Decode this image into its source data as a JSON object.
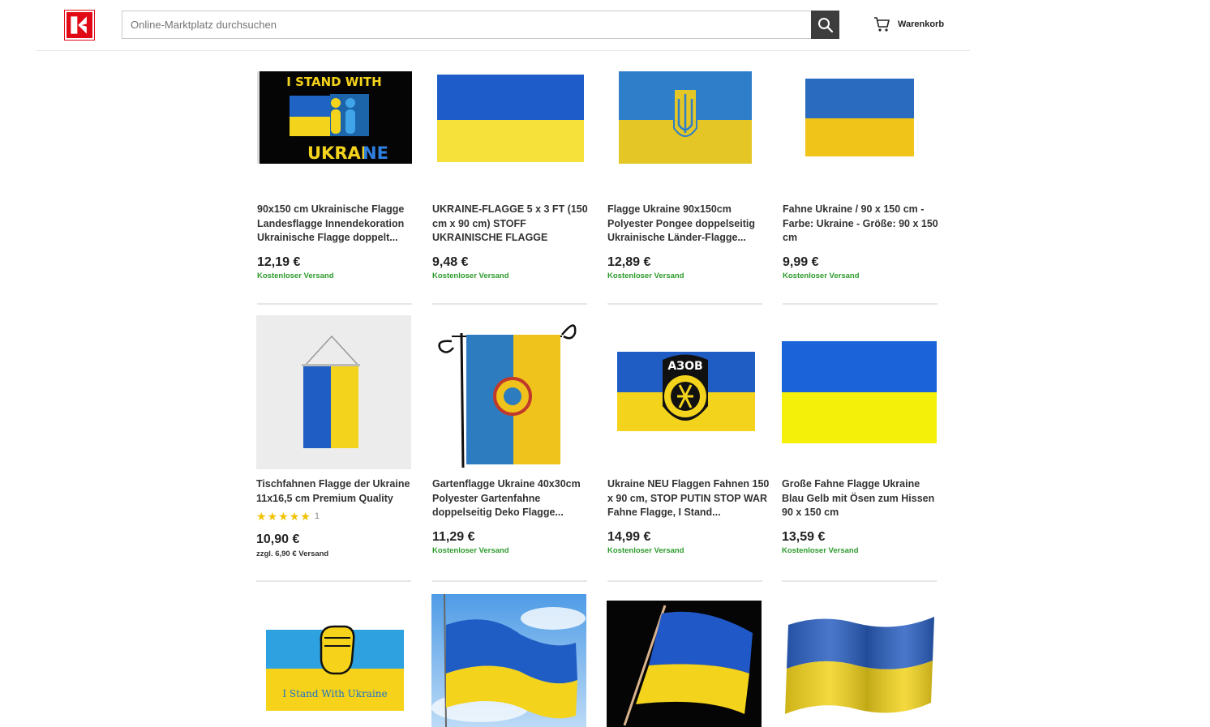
{
  "header": {
    "logo_letter": "K",
    "search_placeholder": "Online-Marktplatz durchsuchen",
    "cart_label": "Warenkorb"
  },
  "products": [
    {
      "title": "90x150 cm Ukrainische Flagge Landesflagge Innendekoration Ukrainische Flagge doppelt...",
      "price": "12,19 €",
      "shipping": "Kostenloser Versand",
      "image_text_top": "I STAND WITH",
      "image_text_bottom": "UKRAI",
      "image_text_bottom_accent": "NE"
    },
    {
      "title": "UKRAINE-FLAGGE 5 x 3 FT (150 cm x 90 cm) STOFF UKRAINISCHE FLAGGE",
      "price": "9,48 €",
      "shipping": "Kostenloser Versand"
    },
    {
      "title": "Flagge Ukraine 90x150cm Polyester Pongee doppelseitig Ukrainische Länder-Flagge...",
      "price": "12,89 €",
      "shipping": "Kostenloser Versand"
    },
    {
      "title": "Fahne Ukraine / 90 x 150 cm - Farbe: Ukraine - Größe: 90 x 150 cm",
      "price": "9,99 €",
      "shipping": "Kostenloser Versand"
    },
    {
      "title": "Tischfahnen Flagge der Ukraine 11x16,5 cm Premium Quality",
      "price": "10,90 €",
      "shipping": "zzgl. 6,90 € Versand",
      "rating": 5,
      "rating_count": "1"
    },
    {
      "title": "Gartenflagge Ukraine 40x30cm Polyester Gartenfahne doppelseitig Deko Flagge...",
      "price": "11,29 €",
      "shipping": "Kostenloser Versand"
    },
    {
      "title": "Ukraine NEU Flaggen Fahnen 150 x 90 cm, STOP PUTIN STOP WAR Fahne Flagge, I Stand...",
      "price": "14,99 €",
      "shipping": "Kostenloser Versand",
      "image_text": "АЗОВ"
    },
    {
      "title": "Große Fahne Flagge Ukraine Blau Gelb mit Ösen zum Hissen 90 x 150 cm",
      "price": "13,59 €",
      "shipping": "Kostenloser Versand"
    },
    {
      "image_text": "I Stand With Ukraine"
    },
    {},
    {},
    {}
  ],
  "colors": {
    "brand_red": "#e10915",
    "flag_blue": "#1f63c4",
    "flag_yellow": "#f4d31c",
    "shipping_green": "#2d9b2d",
    "search_button": "#3d3d3d"
  },
  "icons": {
    "search": "magnifier-icon",
    "cart": "shopping-cart-icon",
    "star": "star-icon"
  }
}
